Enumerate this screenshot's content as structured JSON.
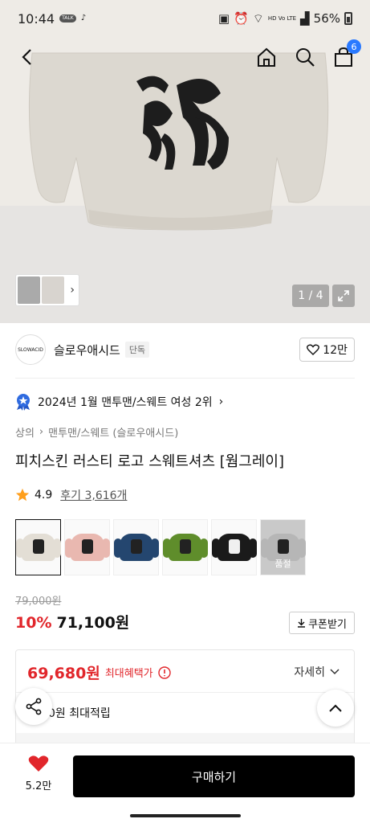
{
  "status_bar": {
    "time": "10:44",
    "battery": "56%",
    "network_label": "HD Vo LTE"
  },
  "header": {
    "cart_count": "6"
  },
  "gallery": {
    "page_indicator": "1 / 4"
  },
  "brand": {
    "logo_text": "SLOWACID",
    "name": "슬로우애시드",
    "tag": "단독",
    "like_count": "12만"
  },
  "ranking": {
    "text": "2024년 1월 맨투맨/스웨트 여성 2위"
  },
  "breadcrumb": {
    "category": "상의",
    "subcategory": "맨투맨/스웨트 (슬로우애시드)"
  },
  "product": {
    "title": "피치스킨 러스티 로고 스웨트셔츠 [웜그레이]",
    "rating": "4.9",
    "review_label": "후기 3,616개"
  },
  "swatches": [
    {
      "color": "#e3ded5",
      "selected": true,
      "sold_out": false
    },
    {
      "color": "#e9b8b0",
      "selected": false,
      "sold_out": false
    },
    {
      "color": "#24466f",
      "selected": false,
      "sold_out": false
    },
    {
      "color": "#5f8d2b",
      "selected": false,
      "sold_out": false
    },
    {
      "color": "#1a1a1a",
      "selected": false,
      "sold_out": false
    },
    {
      "color": "#b6b6b6",
      "selected": false,
      "sold_out": true
    }
  ],
  "sold_out_label": "품절",
  "price": {
    "original": "79,000원",
    "discount": "10%",
    "sale": "71,100원",
    "coupon_label": "쿠폰받기"
  },
  "benefit": {
    "max_price": "69,680원",
    "max_label": "최대혜택가",
    "detail_label": "자세히",
    "points_text": "0원 최대적립"
  },
  "bottom": {
    "heart_count": "5.2만",
    "buy_label": "구매하기"
  },
  "colors": {
    "accent_red": "#e1262b",
    "badge_blue": "#2979ff",
    "buy_button": "#000000"
  }
}
